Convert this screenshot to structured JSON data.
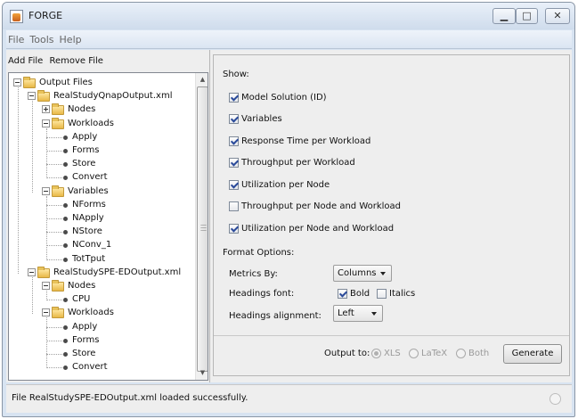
{
  "window": {
    "title": "FORGE"
  },
  "menu": [
    "File",
    "Tools",
    "Help"
  ],
  "toolbar": {
    "add_file": "Add File",
    "remove_file": "Remove File"
  },
  "tree": [
    {
      "label": "Output Files",
      "level": 0,
      "kind": "folder",
      "expanded": true
    },
    {
      "label": "RealStudyQnapOutput.xml",
      "level": 1,
      "kind": "folder",
      "expanded": true
    },
    {
      "label": "Nodes",
      "level": 2,
      "kind": "folder",
      "expanded": false
    },
    {
      "label": "Workloads",
      "level": 2,
      "kind": "folder",
      "expanded": true
    },
    {
      "label": "Apply",
      "level": 3,
      "kind": "leaf"
    },
    {
      "label": "Forms",
      "level": 3,
      "kind": "leaf"
    },
    {
      "label": "Store",
      "level": 3,
      "kind": "leaf"
    },
    {
      "label": "Convert",
      "level": 3,
      "kind": "leaf"
    },
    {
      "label": "Variables",
      "level": 2,
      "kind": "folder",
      "expanded": true
    },
    {
      "label": "NForms",
      "level": 3,
      "kind": "leaf"
    },
    {
      "label": "NApply",
      "level": 3,
      "kind": "leaf"
    },
    {
      "label": "NStore",
      "level": 3,
      "kind": "leaf"
    },
    {
      "label": "NConv_1",
      "level": 3,
      "kind": "leaf"
    },
    {
      "label": "TotTput",
      "level": 3,
      "kind": "leaf"
    },
    {
      "label": "RealStudySPE-EDOutput.xml",
      "level": 1,
      "kind": "folder",
      "expanded": true
    },
    {
      "label": "Nodes",
      "level": 2,
      "kind": "folder",
      "expanded": true
    },
    {
      "label": "CPU",
      "level": 3,
      "kind": "leaf"
    },
    {
      "label": "Workloads",
      "level": 2,
      "kind": "folder",
      "expanded": true
    },
    {
      "label": "Apply",
      "level": 3,
      "kind": "leaf"
    },
    {
      "label": "Forms",
      "level": 3,
      "kind": "leaf"
    },
    {
      "label": "Store",
      "level": 3,
      "kind": "leaf"
    },
    {
      "label": "Convert",
      "level": 3,
      "kind": "leaf"
    }
  ],
  "show": {
    "title": "Show:",
    "options": [
      {
        "label": "Model Solution (ID)",
        "checked": true
      },
      {
        "label": "Variables",
        "checked": true
      },
      {
        "label": "Response Time per Workload",
        "checked": true
      },
      {
        "label": "Throughput per Workload",
        "checked": true
      },
      {
        "label": "Utilization per Node",
        "checked": true
      },
      {
        "label": "Throughput per Node and Workload",
        "checked": false
      },
      {
        "label": "Utilization per Node and Workload",
        "checked": true
      }
    ]
  },
  "format": {
    "title": "Format Options:",
    "metrics_label": "Metrics By:",
    "metrics_value": "Columns",
    "headings_font_label": "Headings font:",
    "bold_label": "Bold",
    "bold_checked": true,
    "italics_label": "Italics",
    "italics_checked": false,
    "alignment_label": "Headings alignment:",
    "alignment_value": "Left"
  },
  "output": {
    "label": "Output to:",
    "options": [
      {
        "label": "XLS",
        "selected": true
      },
      {
        "label": "LaTeX",
        "selected": false
      },
      {
        "label": "Both",
        "selected": false
      }
    ],
    "generate_label": "Generate"
  },
  "status": {
    "message": "File RealStudySPE-EDOutput.xml loaded successfully."
  }
}
